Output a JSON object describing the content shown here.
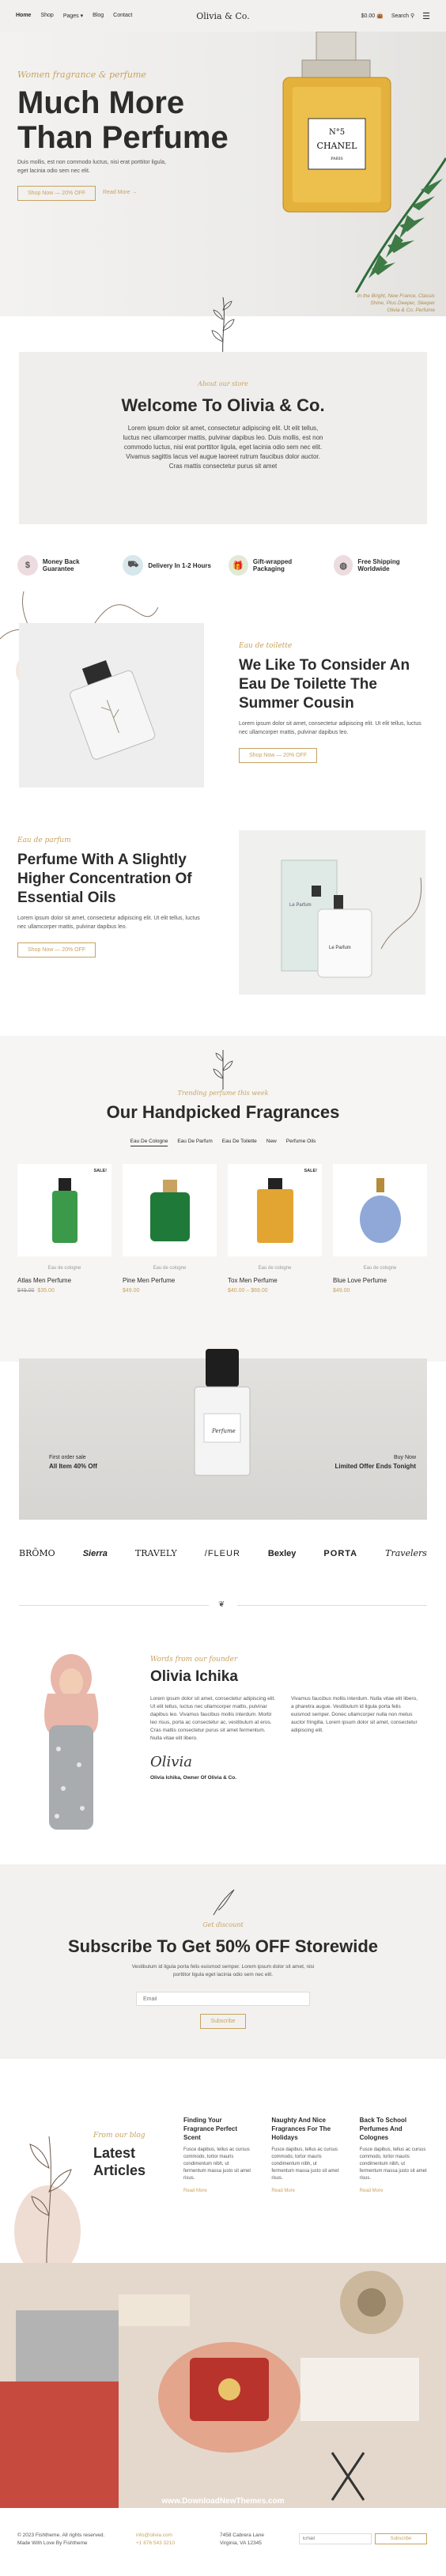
{
  "header": {
    "nav": [
      "Home",
      "Shop",
      "Pages",
      "Blog",
      "Contact"
    ],
    "logo": "Olivia & Co.",
    "cart": "$0.00",
    "search": "Search"
  },
  "hero": {
    "kicker": "Women fragrance & perfume",
    "title": "Much More Than Perfume",
    "desc": "Duis mollis, est non commodo luctus, nisi erat porttitor ligula, eget lacinia odio sem nec elit.",
    "btn_primary": "Shop Now — 20% OFF",
    "btn_secondary": "Read More",
    "caption_1": "In the Bright, New France, Classic",
    "caption_2": "Shine, Plus Deeper, Sleeper",
    "caption_3": "Olivia & Co. Perfume"
  },
  "welcome": {
    "kicker": "About our store",
    "title": "Welcome To Olivia & Co.",
    "text": "Lorem ipsum dolor sit amet, consectetur adipiscing elit. Ut elit tellus, luctus nec ullamcorper mattis, pulvinar dapibus leo. Duis mollis, est non commodo luctus, nisi erat porttitor ligula, eget lacinia odio sem nec elit. Vivamus sagittis lacus vel augue laoreet rutrum faucibus dolor auctor. Cras mattis consectetur purus sit amet"
  },
  "features": [
    {
      "label": "Money Back Guarantee",
      "icon": "wallet-icon"
    },
    {
      "label": "Delivery In 1-2 Hours",
      "icon": "truck-icon"
    },
    {
      "label": "Gift-wrapped Packaging",
      "icon": "gift-icon"
    },
    {
      "label": "Free Shipping Worldwide",
      "icon": "globe-icon"
    }
  ],
  "section1": {
    "kicker": "Eau de toilette",
    "title": "We Like To Consider An Eau De Toilette The Summer Cousin",
    "text": "Lorem ipsum dolor sit amet, consectetur adipiscing elit. Ut elit tellus, luctus nec ullamcorper mattis, pulvinar dapibus leo.",
    "btn": "Shop Now — 20% OFF"
  },
  "section2": {
    "kicker": "Eau de parfum",
    "title": "Perfume With A Slightly Higher Concentration Of Essential Oils",
    "text": "Lorem ipsum dolor sit amet, consectetur adipiscing elit. Ut elit tellus, luctus nec ullamcorper mattis, pulvinar dapibus leo.",
    "btn": "Shop Now — 20% OFF",
    "box_label": "Le Parfum",
    "bottle_label": "Le Parfum"
  },
  "fragrances": {
    "kicker": "Trending perfume this week",
    "title": "Our Handpicked Fragrances",
    "tabs": [
      "Eau De Cologne",
      "Eau De Parfum",
      "Eau De Toilette",
      "New",
      "Perfume Oils"
    ],
    "products": [
      {
        "sale": "SALE!",
        "category": "Eau de cologne",
        "name": "Atlas Men Perfume",
        "old_price": "$49.00",
        "price": "$35.00",
        "color": "#3a9a4a"
      },
      {
        "sale": "",
        "category": "Eau de cologne",
        "name": "Pine Men Perfume",
        "old_price": "",
        "price": "$49.00",
        "color": "#1f7a3a"
      },
      {
        "sale": "SALE!",
        "category": "Eau de cologne",
        "name": "Tox Men Perfume",
        "old_price": "",
        "price": "$40.00 – $69.00",
        "color": "#e3a531"
      },
      {
        "sale": "",
        "category": "Eau de cologne",
        "name": "Blue Love Perfume",
        "old_price": "",
        "price": "$49.00",
        "color": "#8fa8d8"
      }
    ]
  },
  "promo": {
    "left_small": "First order sale",
    "left_big": "All Item 40% Off",
    "right_small": "Buy Now",
    "right_big": "Limited Offer Ends Tonight",
    "bottle_label": "Perfume"
  },
  "brands": [
    "BRŌMO",
    "Sierra",
    "TRAVELY",
    "/FLEUR",
    "Bexley",
    "PORTA",
    "Travelers"
  ],
  "founder": {
    "kicker": "Words from our founder",
    "name": "Olivia Ichika",
    "col1": "Lorem ipsum dolor sit amet, consectetur adipiscing elit. Ut elit tellus, luctus nec ullamcorper mattis, pulvinar dapibus leo. Vivamus faucibus mollis interdum. Morbi leo risus, porta ac consectetur ac, vestibulum at eros. Cras mattis consectetur purus sit amet fermentum. Nulla vitae elit libero.",
    "col2": "Vivamus faucibus mollis interdum. Nulla vitae elit libero, a pharetra augue. Vestibulum id ligula porta felis euismod semper. Donec ullamcorper nulla non metus auctor fringilla. Lorem ipsum dolor sit amet, consectetur adipiscing elit.",
    "signature": "Olivia",
    "owner": "Olivia Ichika, Owner Of Olivia & Co."
  },
  "subscribe": {
    "kicker": "Get discount",
    "title": "Subscribe To Get 50% OFF Storewide",
    "text": "Vestibulum id ligula porta felis euismod semper. Lorem ipsum dolor sit amet, nisi porttitor ligula eget lacinia odio sem nec elit.",
    "email_placeholder": "Email",
    "btn": "Subscribe"
  },
  "articles": {
    "kicker": "From our blog",
    "title": "Latest Articles",
    "items": [
      {
        "title": "Finding Your Fragrance Perfect Scent",
        "excerpt": "Fusce dapibus, tellus ac cursus commodo, tortor mauris condimentum nibh, ut fermentum massa justo sit amet risus.",
        "more": "Read More"
      },
      {
        "title": "Naughty And Nice Fragrances For The Holidays",
        "excerpt": "Fusce dapibus, tellus ac cursus commodo, tortor mauris condimentum nibh, ut fermentum massa justo sit amet risus.",
        "more": "Read More"
      },
      {
        "title": "Back To School Perfumes And Colognes",
        "excerpt": "Fusce dapibus, tellus ac cursus commodo, tortor mauris condimentum nibh, ut fermentum massa justo sit amet risus.",
        "more": "Read More"
      }
    ]
  },
  "watermark": "www.DownloadNewThemes.com",
  "footer": {
    "copyright": "© 2023 Fishtheme. All rights reserved.",
    "credit": "Made With Love By Fishtheme",
    "email": "info@olivia.com",
    "phone": "+1 876 543 3210",
    "address_1": "7458 Cabrera Lane",
    "address_2": "Virginia, VA 12345",
    "email_placeholder": "Email",
    "btn": "Subscribe"
  }
}
